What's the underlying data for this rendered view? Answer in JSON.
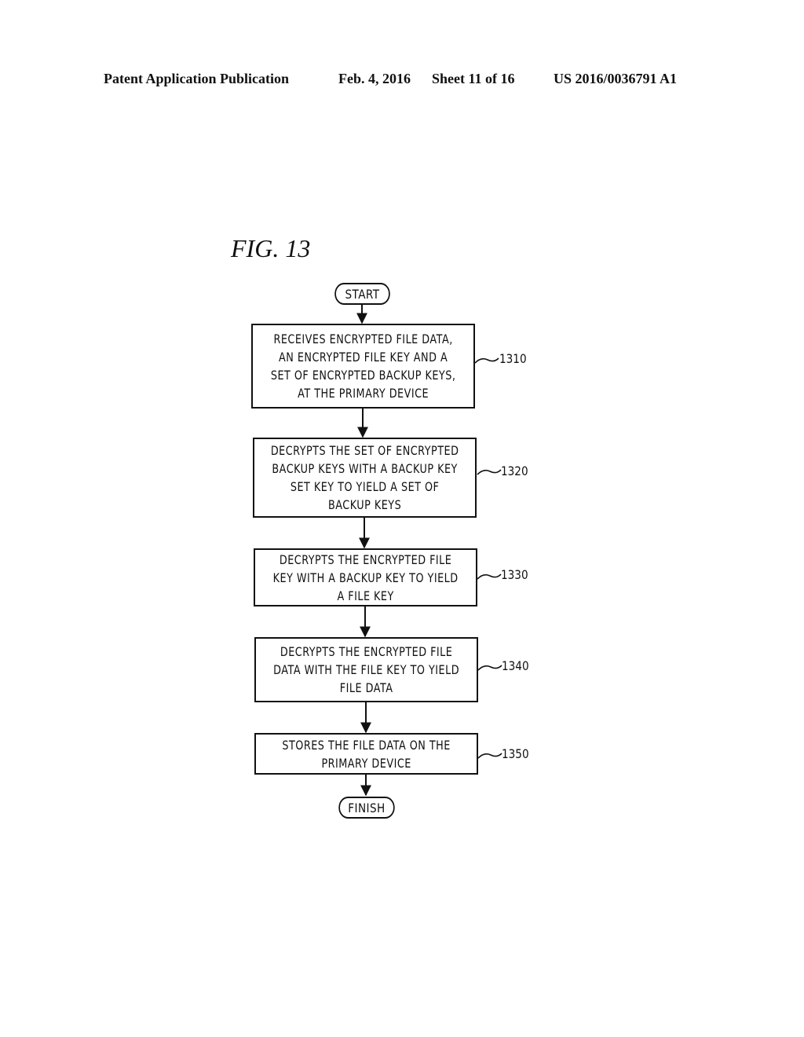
{
  "header": {
    "publication": "Patent Application Publication",
    "date": "Feb. 4, 2016",
    "sheet": "Sheet 11 of 16",
    "number": "US 2016/0036791 A1"
  },
  "figure": {
    "title": "FIG. 13",
    "start_label": "START",
    "finish_label": "FINISH",
    "steps": [
      {
        "ref": "1310",
        "text": "RECEIVES ENCRYPTED FILE DATA,\nAN ENCRYPTED FILE KEY AND A\nSET OF ENCRYPTED BACKUP KEYS,\nAT THE PRIMARY DEVICE"
      },
      {
        "ref": "1320",
        "text": "DECRYPTS THE SET OF ENCRYPTED\nBACKUP KEYS WITH A BACKUP KEY\nSET KEY TO YIELD A SET OF\nBACKUP KEYS"
      },
      {
        "ref": "1330",
        "text": "DECRYPTS THE ENCRYPTED FILE\nKEY WITH A BACKUP KEY TO YIELD\nA FILE KEY"
      },
      {
        "ref": "1340",
        "text": "DECRYPTS THE ENCRYPTED FILE\nDATA WITH THE FILE KEY TO YIELD\nFILE DATA"
      },
      {
        "ref": "1350",
        "text": "STORES THE FILE DATA ON THE\nPRIMARY DEVICE"
      }
    ]
  }
}
